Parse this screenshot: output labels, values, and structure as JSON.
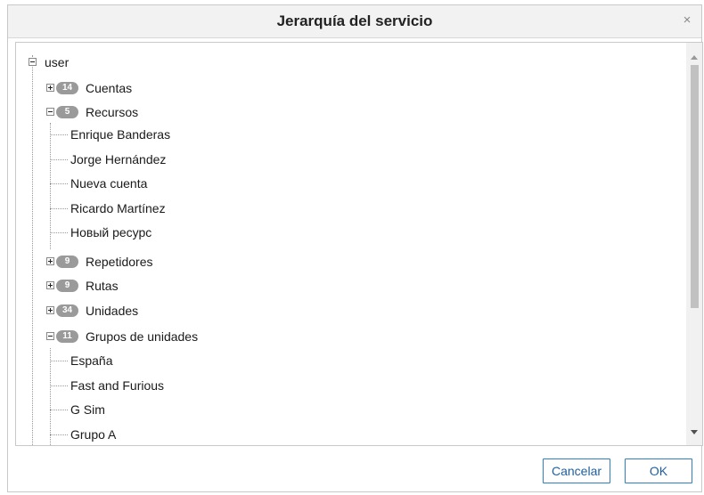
{
  "dialog": {
    "title": "Jerarquía del servicio",
    "close_glyph": "×"
  },
  "tree": {
    "root": "user",
    "groups": [
      {
        "label": "Cuentas",
        "count": "14",
        "expanded": false,
        "children": []
      },
      {
        "label": "Recursos",
        "count": "5",
        "expanded": true,
        "children": [
          "Enrique Banderas",
          "Jorge Hernández",
          "Nueva cuenta",
          "Ricardo Martínez",
          "Новый ресурс"
        ]
      },
      {
        "label": "Repetidores",
        "count": "9",
        "expanded": false,
        "children": []
      },
      {
        "label": "Rutas",
        "count": "9",
        "expanded": false,
        "children": []
      },
      {
        "label": "Unidades",
        "count": "34",
        "expanded": false,
        "children": []
      },
      {
        "label": "Grupos de unidades",
        "count": "11",
        "expanded": true,
        "children": [
          "España",
          "Fast and Furious",
          "G Sim",
          "Grupo A"
        ]
      }
    ]
  },
  "buttons": {
    "cancel": "Cancelar",
    "ok": "OK"
  },
  "colors": {
    "badge": "#9a9a9a",
    "button_border": "#2f7fc8",
    "button_text": "#1f5f9f"
  }
}
